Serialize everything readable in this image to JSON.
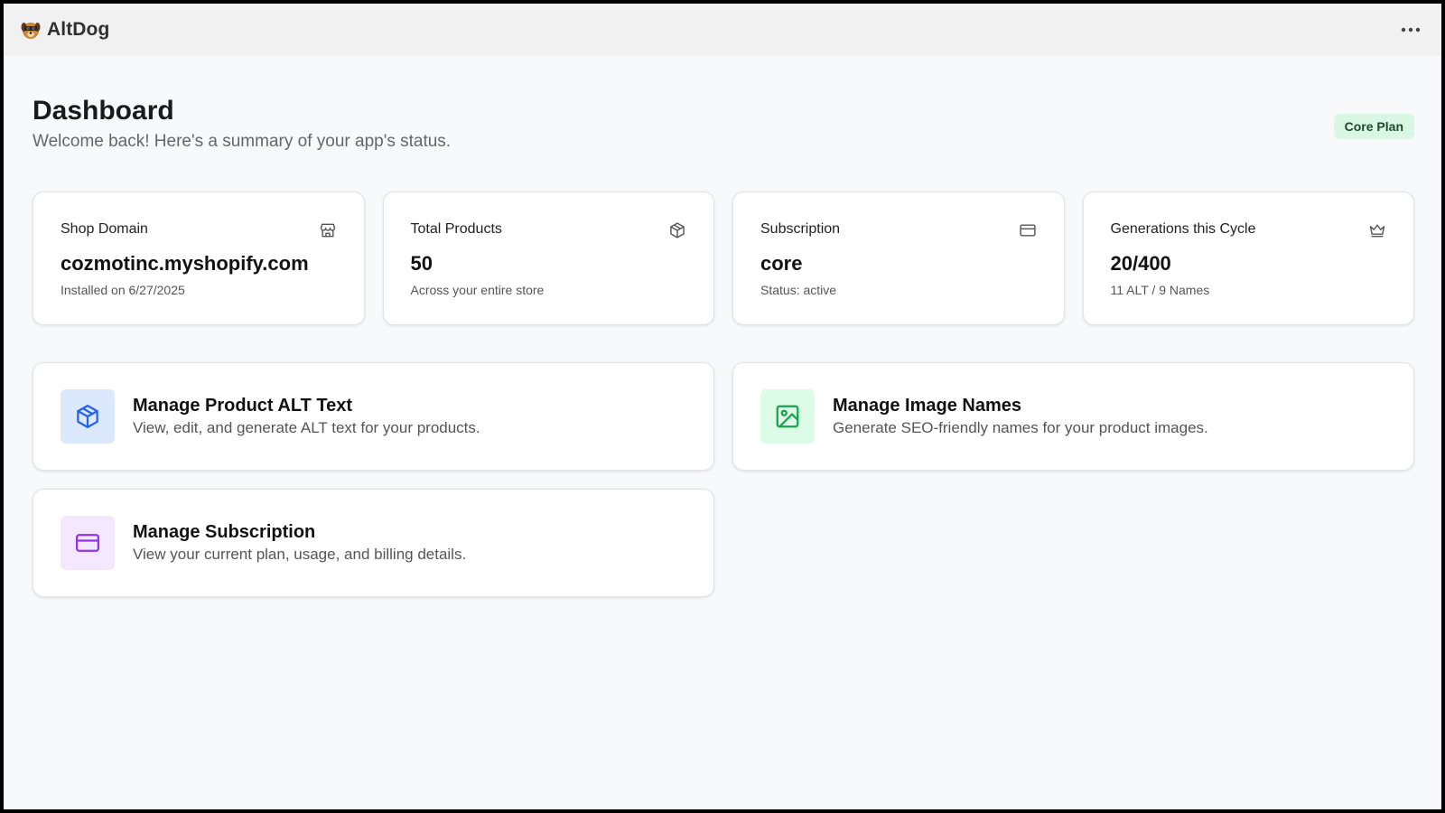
{
  "header": {
    "app_name": "AltDog",
    "logo_icon": "dog-logo-icon",
    "menu_icon": "more-horizontal-icon"
  },
  "page": {
    "title": "Dashboard",
    "subtitle": "Welcome back! Here's a summary of your app's status.",
    "plan_badge": "Core Plan"
  },
  "stats": [
    {
      "label": "Shop Domain",
      "value": "cozmotinc.myshopify.com",
      "sub": "Installed on 6/27/2025",
      "icon": "store-icon"
    },
    {
      "label": "Total Products",
      "value": "50",
      "sub": "Across your entire store",
      "icon": "package-icon"
    },
    {
      "label": "Subscription",
      "value": "core",
      "sub": "Status: active",
      "icon": "credit-card-icon"
    },
    {
      "label": "Generations this Cycle",
      "value": "20/400",
      "sub": "11 ALT / 9 Names",
      "icon": "crown-icon"
    }
  ],
  "actions": [
    {
      "title": "Manage Product ALT Text",
      "desc": "View, edit, and generate ALT text for your products.",
      "icon": "package-icon",
      "icon_color": "#2563eb",
      "icon_bg": "#dbe8fe"
    },
    {
      "title": "Manage Image Names",
      "desc": "Generate SEO-friendly names for your product images.",
      "icon": "image-icon",
      "icon_color": "#16a34a",
      "icon_bg": "#dcfce7"
    },
    {
      "title": "Manage Subscription",
      "desc": "View your current plan, usage, and billing details.",
      "icon": "credit-card-icon",
      "icon_color": "#9333ea",
      "icon_bg": "#f3e8ff"
    }
  ],
  "colors": {
    "badge_bg": "#d9f7e3",
    "badge_text": "#1e4a2b"
  }
}
